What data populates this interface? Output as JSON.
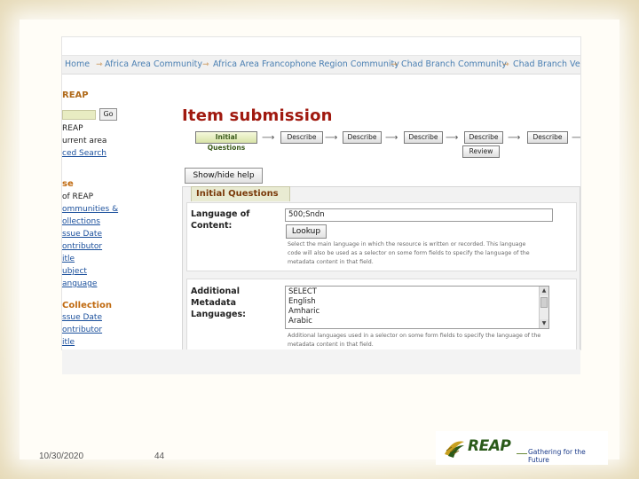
{
  "breadcrumb": {
    "home": "Home",
    "items": [
      "Africa Area Community",
      "Africa Area Francophone Region Community",
      "Chad Branch Community",
      "Chad Branch Vers"
    ]
  },
  "sidebar": {
    "brand": "REAP",
    "go_label": "Go",
    "search_scope": [
      "REAP",
      "urrent area"
    ],
    "advanced_search": "ced Search",
    "browse_heading": "se",
    "browse_items": [
      "of REAP",
      "ommunities &",
      "ollections",
      "ssue Date",
      "ontributor",
      "itle",
      "ubject",
      "anguage"
    ],
    "collection_heading": "Collection",
    "collection_items": [
      "ssue Date",
      "ontributor",
      "itle"
    ]
  },
  "main": {
    "title": "Item submission",
    "steps": [
      "Initial Questions",
      "Describe",
      "Describe",
      "Describe",
      "Describe",
      "Describe",
      "Review"
    ],
    "help_button": "Show/hide help",
    "section_tab": "Initial Questions",
    "language_field": {
      "label_line1": "Language of",
      "label_line2": "Content:",
      "value": "500;Sndn",
      "lookup_label": "Lookup",
      "hint_line1": "Select the main language in which the resource is written or recorded. This language",
      "hint_line2": "code will also be used as a selector on some form fields to specify the language of the",
      "hint_line3": "metadata content in that field."
    },
    "additional_field": {
      "label_line1": "Additional",
      "label_line2": "Metadata",
      "label_line3": "Languages:",
      "options": [
        "SELECT",
        "English",
        "Amharic",
        "Arabic"
      ],
      "hint_line1": "Additional languages used in a selector on some form fields to specify the language of the",
      "hint_line2": "metadata content in that field."
    }
  },
  "footer": {
    "date": "10/30/2020",
    "page_number": "44",
    "logo_text": "REAP",
    "tagline": "Gathering for the Future"
  },
  "icons": {
    "breadcrumb_separator": "arrow-icon",
    "step_connector": "long-arrow-icon"
  },
  "colors": {
    "title": "#a0190f",
    "links": "#1a4f9c",
    "section_heading": "#c06a10",
    "logo_green": "#2a5a1a"
  }
}
